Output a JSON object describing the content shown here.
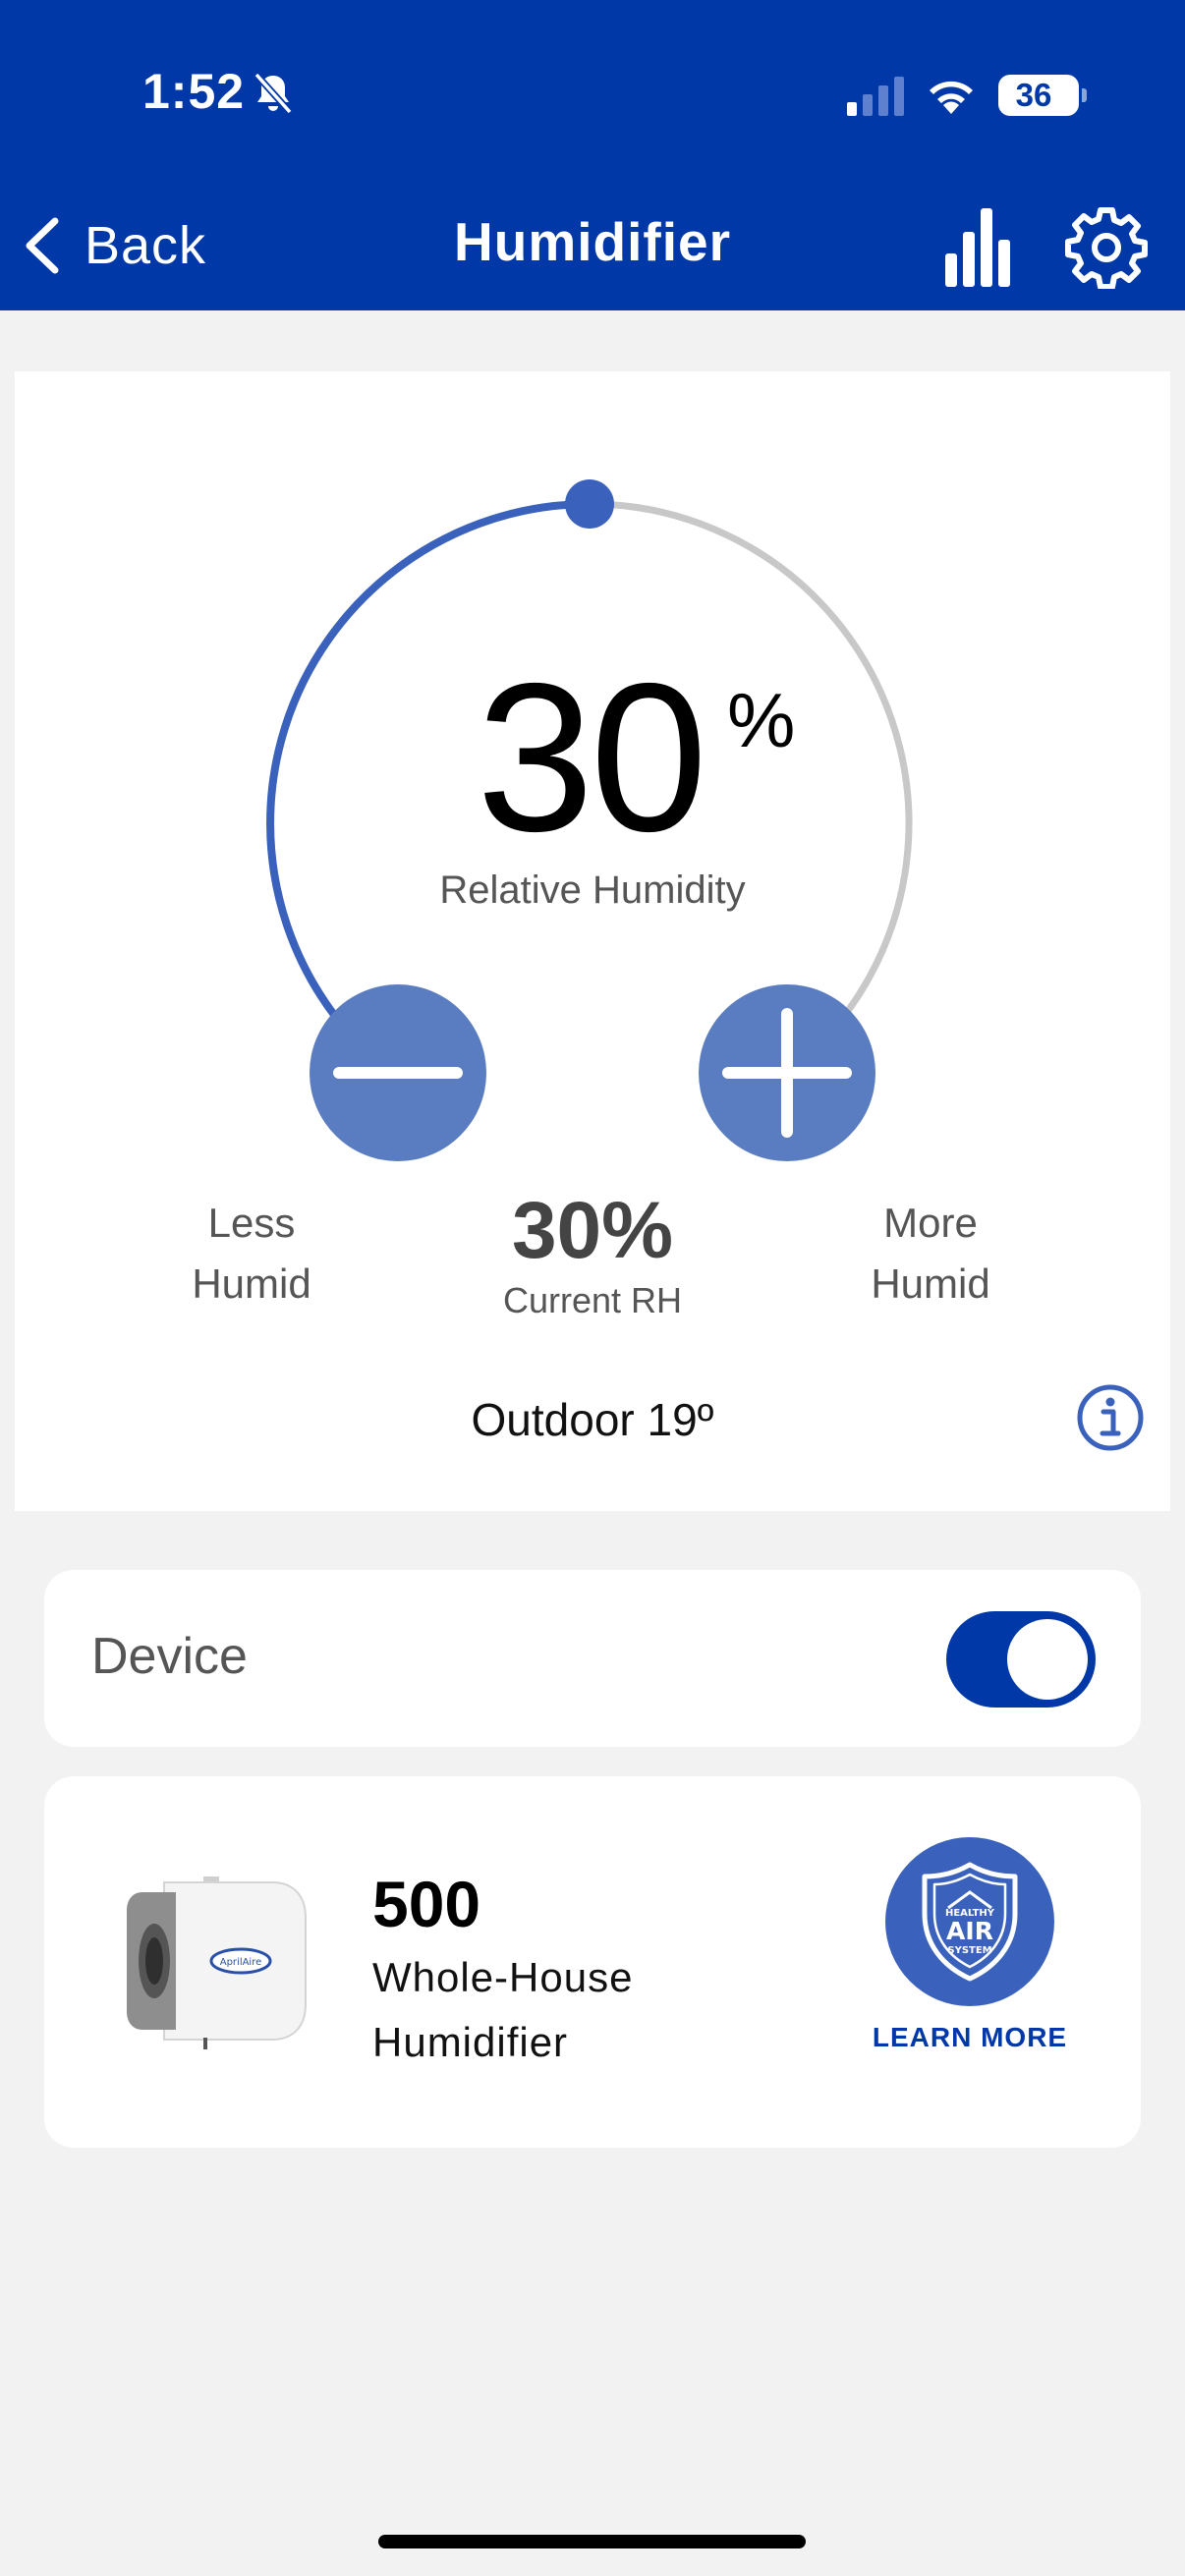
{
  "status_bar": {
    "time": "1:52",
    "battery": "36"
  },
  "nav": {
    "back_label": "Back",
    "title": "Humidifier"
  },
  "dial": {
    "setpoint_value": "30",
    "setpoint_unit": "%",
    "setpoint_label": "Relative Humidity",
    "setpoint_fraction": 0.5,
    "less_label_line1": "Less",
    "less_label_line2": "Humid",
    "more_label_line1": "More",
    "more_label_line2": "Humid",
    "current_value": "30%",
    "current_label": "Current RH",
    "outdoor": "Outdoor 19º"
  },
  "device": {
    "label": "Device",
    "enabled": true
  },
  "product": {
    "model": "500",
    "desc_line1": "Whole-House",
    "desc_line2": "Humidifier",
    "brand_text": "AprilAire",
    "badge_line1": "HEALTHY",
    "badge_line2": "AIR",
    "badge_line3": "SYSTEM",
    "learn_more": "LEARN MORE"
  },
  "colors": {
    "header": "#0038a8",
    "accent": "#3a62bd",
    "button": "#5a7cc0",
    "track": "#c8c8c8",
    "background": "#f2f2f2"
  }
}
